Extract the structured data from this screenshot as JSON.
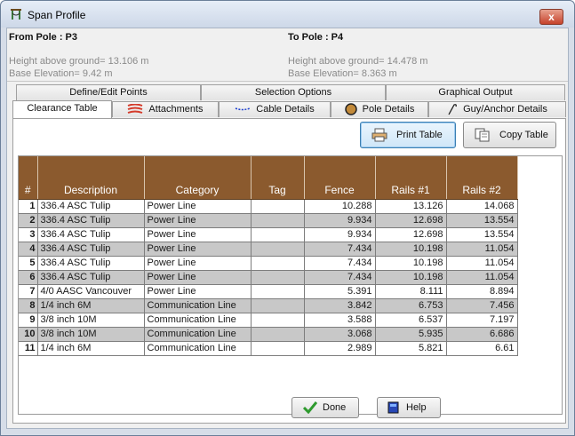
{
  "window": {
    "title": "Span Profile",
    "close_glyph": "x"
  },
  "from_pole": {
    "title": "From Pole : P3",
    "height_text": "Height above ground= 13.106 m",
    "elevation_text": "Base Elevation= 9.42 m"
  },
  "to_pole": {
    "title": "To Pole : P4",
    "height_text": "Height above ground= 14.478 m",
    "elevation_text": "Base Elevation= 8.363 m"
  },
  "tabs_row1": [
    "Define/Edit Points",
    "Selection Options",
    "Graphical Output"
  ],
  "tabs_row2": [
    "Clearance Table",
    "Attachments",
    "Cable Details",
    "Pole Details",
    "Guy/Anchor Details"
  ],
  "active_tab": "Clearance Table",
  "buttons": {
    "print": "Print Table",
    "copy": "Copy Table",
    "done": "Done",
    "help": "Help"
  },
  "table": {
    "columns": [
      "#",
      "Description",
      "Category",
      "Tag",
      "Fence",
      "Rails #1",
      "Rails #2"
    ],
    "rows": [
      [
        "1",
        "336.4 ASC Tulip",
        "Power Line",
        "",
        "10.288",
        "13.126",
        "14.068"
      ],
      [
        "2",
        "336.4 ASC Tulip",
        "Power Line",
        "",
        "9.934",
        "12.698",
        "13.554"
      ],
      [
        "3",
        "336.4 ASC Tulip",
        "Power Line",
        "",
        "9.934",
        "12.698",
        "13.554"
      ],
      [
        "4",
        "336.4 ASC Tulip",
        "Power Line",
        "",
        "7.434",
        "10.198",
        "11.054"
      ],
      [
        "5",
        "336.4 ASC Tulip",
        "Power Line",
        "",
        "7.434",
        "10.198",
        "11.054"
      ],
      [
        "6",
        "336.4 ASC Tulip",
        "Power Line",
        "",
        "7.434",
        "10.198",
        "11.054"
      ],
      [
        "7",
        "4/0 AASC Vancouver",
        "Power Line",
        "",
        "5.391",
        "8.111",
        "8.894"
      ],
      [
        "8",
        "1/4 inch 6M",
        "Communication Line",
        "",
        "3.842",
        "6.753",
        "7.456"
      ],
      [
        "9",
        "3/8 inch 10M",
        "Communication Line",
        "",
        "3.588",
        "6.537",
        "7.197"
      ],
      [
        "10",
        "3/8 inch 10M",
        "Communication Line",
        "",
        "3.068",
        "5.935",
        "6.686"
      ],
      [
        "11",
        "1/4 inch 6M",
        "Communication Line",
        "",
        "2.989",
        "5.821",
        "6.61"
      ]
    ]
  },
  "icons": {
    "title": "span-profile-icon",
    "attachments": "attachments-icon",
    "cable": "cable-details-icon",
    "pole": "pole-details-icon",
    "guy": "guy-anchor-icon",
    "print": "printer-icon",
    "copy": "copy-icon",
    "done": "checkmark-icon",
    "help": "help-book-icon"
  },
  "colors": {
    "header_bg": "#8b5a2e",
    "row_alt": "#c8c8c8",
    "attachments_icon": "#d43a2a",
    "cable_icon": "#1c3fd0",
    "pole_icon": "#c28a3a",
    "done_check": "#2e9a2e"
  }
}
